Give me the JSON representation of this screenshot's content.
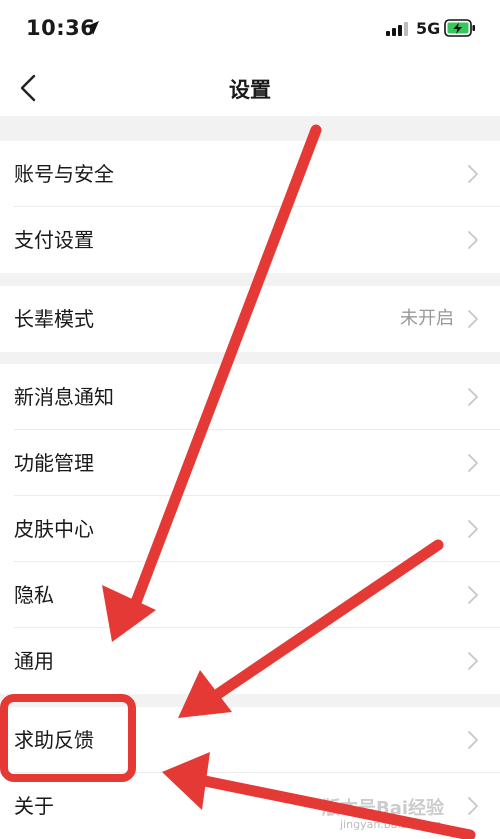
{
  "status": {
    "time": "10:36",
    "network": "5G",
    "icons": [
      "location-arrow-icon",
      "signal-icon",
      "battery-charging-icon"
    ]
  },
  "header": {
    "title": "设置",
    "back_icon": "chevron-left-icon"
  },
  "settings": {
    "account_security": "账号与安全",
    "payment": "支付设置",
    "elder_mode": "长辈模式",
    "elder_mode_value": "未开启",
    "notifications": "新消息通知",
    "features": "功能管理",
    "skins": "皮肤中心",
    "privacy": "隐私",
    "general": "通用",
    "help_feedback": "求助反馈",
    "about": "关于"
  },
  "annotations": {
    "arrow_color": "#e53935",
    "highlight_color": "#e53935"
  },
  "watermark": {
    "text": "版本号Bai经验",
    "url": "jingyan.baidu.com"
  },
  "colors": {
    "background": "#f2f2f2",
    "row": "#ffffff",
    "secondary_text": "#999999",
    "chevron": "#c7c7c7"
  }
}
